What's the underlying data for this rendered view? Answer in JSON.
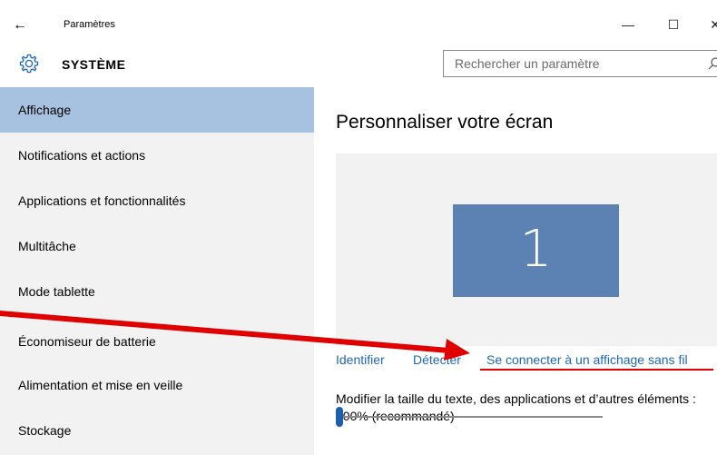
{
  "window": {
    "title": "Paramètres",
    "back_glyph": "←",
    "minimize_glyph": "—",
    "maximize_glyph": "☐",
    "close_glyph": "✕"
  },
  "header": {
    "section": "SYSTÈME",
    "search_placeholder": "Rechercher un paramètre"
  },
  "sidebar": {
    "items": [
      {
        "label": "Affichage",
        "selected": true
      },
      {
        "label": "Notifications et actions"
      },
      {
        "label": "Applications et fonctionnalités"
      },
      {
        "label": "Multitâche"
      },
      {
        "label": "Mode tablette"
      },
      {
        "label": "Économiseur de batterie"
      },
      {
        "label": "Alimentation et mise en veille"
      },
      {
        "label": "Stockage"
      }
    ]
  },
  "main": {
    "title": "Personnaliser votre écran",
    "monitor_number": "1",
    "links": {
      "identify": "Identifier",
      "detect": "Détecter",
      "connect": "Se connecter à un affichage sans fil"
    },
    "scale_label": "Modifier la taille du texte, des applications et d’autres éléments : 100% (recommandé)",
    "scale_slider_fraction": 0.0
  },
  "colors": {
    "accent": "#1d67b9",
    "selected_nav": "#a7c2e0",
    "monitor": "#5c82b3",
    "annotation": "#e00000"
  }
}
